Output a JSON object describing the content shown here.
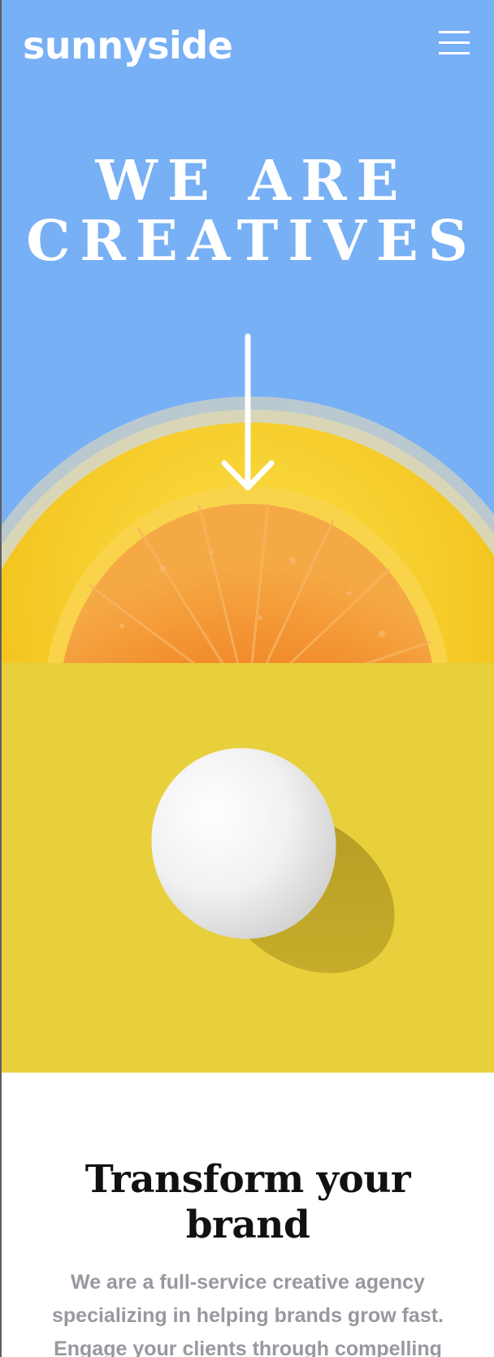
{
  "header": {
    "logo_text": "sunnyside",
    "menu_icon": "hamburger-menu-icon"
  },
  "hero": {
    "title": "WE ARE CREATIVES",
    "scroll_icon": "arrow-down-icon",
    "image": "orange-in-bowl",
    "background_color": "#78b0f5"
  },
  "egg_section": {
    "image": "egg-on-yellow",
    "background_color": "#e8d03c"
  },
  "transform": {
    "title": "Transform your brand",
    "body": "We are a full-service creative agency specializing in helping brands grow fast. Engage your clients through compelling"
  }
}
